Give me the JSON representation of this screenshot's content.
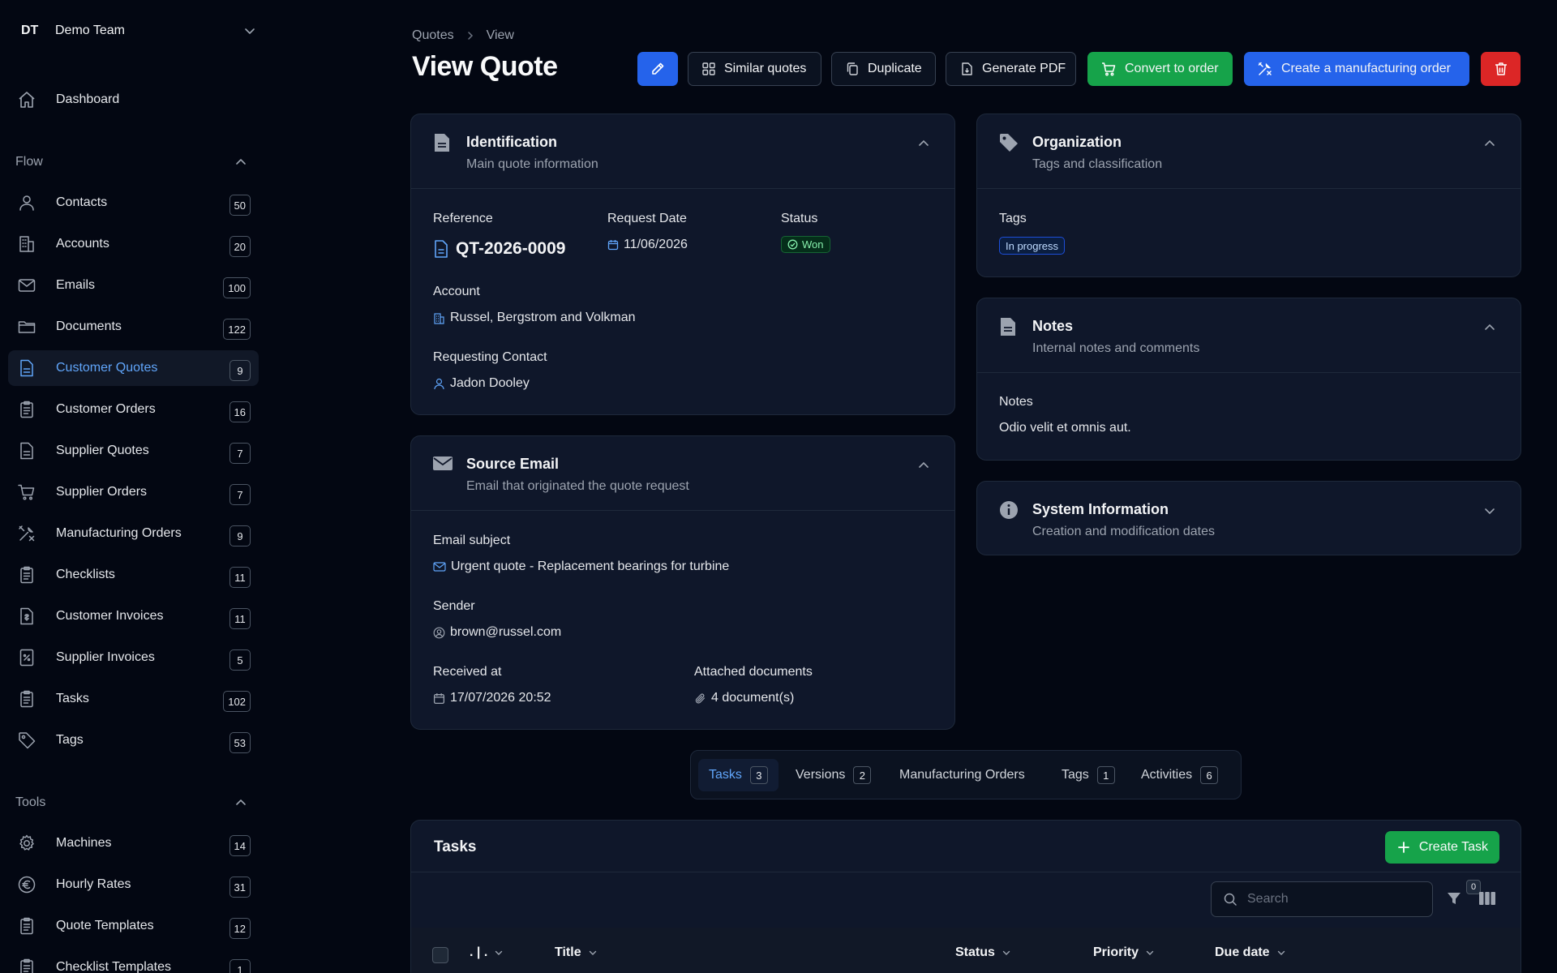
{
  "team": {
    "initials": "DT",
    "name": "Demo Team"
  },
  "sidebar": {
    "dashboard": "Dashboard",
    "flow_title": "Flow",
    "flow_items": [
      {
        "label": "Contacts",
        "count": "50",
        "icon": "user-icon"
      },
      {
        "label": "Accounts",
        "count": "20",
        "icon": "building-icon"
      },
      {
        "label": "Emails",
        "count": "100",
        "icon": "mail-icon"
      },
      {
        "label": "Documents",
        "count": "122",
        "icon": "folder-icon"
      },
      {
        "label": "Customer Quotes",
        "count": "9",
        "icon": "file-icon",
        "active": true
      },
      {
        "label": "Customer Orders",
        "count": "16",
        "icon": "clipboard-icon"
      },
      {
        "label": "Supplier Quotes",
        "count": "7",
        "icon": "file-icon"
      },
      {
        "label": "Supplier Orders",
        "count": "7",
        "icon": "cart-icon"
      },
      {
        "label": "Manufacturing Orders",
        "count": "9",
        "icon": "tools-icon"
      },
      {
        "label": "Checklists",
        "count": "11",
        "icon": "clipboard-icon"
      },
      {
        "label": "Customer Invoices",
        "count": "11",
        "icon": "invoice-icon"
      },
      {
        "label": "Supplier Invoices",
        "count": "5",
        "icon": "receipt-icon"
      },
      {
        "label": "Tasks",
        "count": "102",
        "icon": "clipboard-icon"
      },
      {
        "label": "Tags",
        "count": "53",
        "icon": "tag-icon"
      }
    ],
    "tools_title": "Tools",
    "tools_items": [
      {
        "label": "Machines",
        "count": "14",
        "icon": "gear-icon"
      },
      {
        "label": "Hourly Rates",
        "count": "31",
        "icon": "euro-icon"
      },
      {
        "label": "Quote Templates",
        "count": "12",
        "icon": "clipboard-icon"
      },
      {
        "label": "Checklist Templates",
        "count": "1",
        "icon": "clipboard-icon"
      }
    ]
  },
  "breadcrumb": {
    "parent": "Quotes",
    "current": "View"
  },
  "page_title": "View Quote",
  "toolbar": {
    "similar": "Similar quotes",
    "duplicate": "Duplicate",
    "pdf": "Generate PDF",
    "convert": "Convert to order",
    "manufacture": "Create a manufacturing order"
  },
  "identification": {
    "title": "Identification",
    "subtitle": "Main quote information",
    "reference_label": "Reference",
    "reference": "QT-2026-0009",
    "request_date_label": "Request Date",
    "request_date": "11/06/2026",
    "status_label": "Status",
    "status": "Won",
    "account_label": "Account",
    "account": "Russel, Bergstrom and Volkman",
    "contact_label": "Requesting Contact",
    "contact": "Jadon Dooley"
  },
  "source_email": {
    "title": "Source Email",
    "subtitle": "Email that originated the quote request",
    "subject_label": "Email subject",
    "subject": "Urgent quote - Replacement bearings for turbine",
    "sender_label": "Sender",
    "sender": "brown@russel.com",
    "received_label": "Received at",
    "received": "17/07/2026 20:52",
    "attached_label": "Attached documents",
    "attached": "4 document(s)"
  },
  "organization": {
    "title": "Organization",
    "subtitle": "Tags and classification",
    "tags_label": "Tags",
    "tag": "In progress"
  },
  "notes": {
    "title": "Notes",
    "subtitle": "Internal notes and comments",
    "notes_label": "Notes",
    "notes": "Odio velit et omnis aut."
  },
  "system_info": {
    "title": "System Information",
    "subtitle": "Creation and modification dates"
  },
  "tabs": [
    {
      "label": "Tasks",
      "count": "3"
    },
    {
      "label": "Versions",
      "count": "2"
    },
    {
      "label": "Manufacturing Orders"
    },
    {
      "label": "Tags",
      "count": "1"
    },
    {
      "label": "Activities",
      "count": "6"
    }
  ],
  "tasks_panel": {
    "title": "Tasks",
    "create": "Create Task",
    "search_placeholder": "Search",
    "filter_count": "0",
    "columns": {
      "status_col": ". | .",
      "title": "Title",
      "status": "Status",
      "priority": "Priority",
      "due_date": "Due date"
    }
  },
  "colors": {
    "background": "#030712",
    "card": "#0f172a",
    "accent_blue": "#2563eb",
    "accent_green": "#16a34a",
    "accent_red": "#dc2626",
    "active_link": "#60a5fa"
  }
}
